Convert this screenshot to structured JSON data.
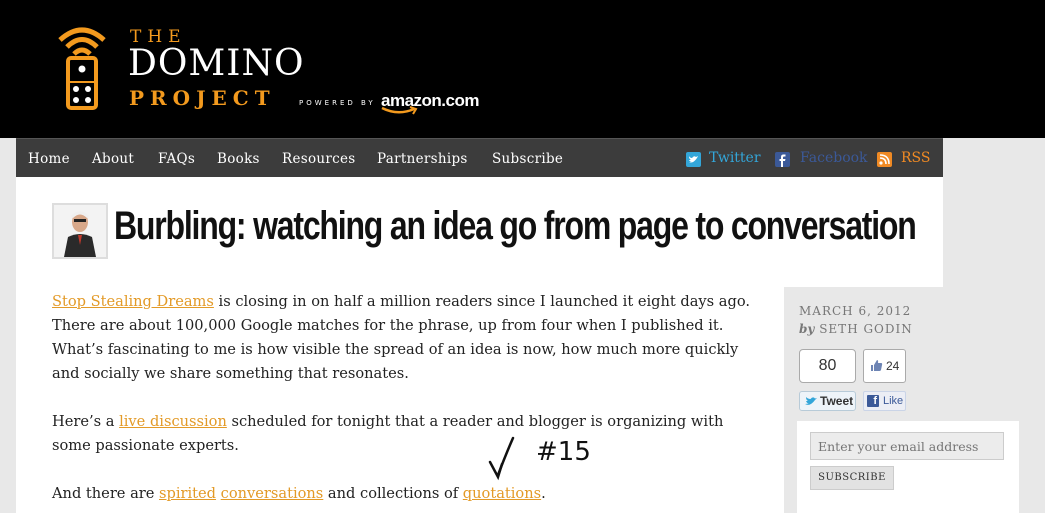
{
  "header": {
    "logo_the": "THE",
    "logo_domino": "DOMINO",
    "logo_project": "PROJECT",
    "powered_by": "POWERED BY",
    "amazon": "amazon.com"
  },
  "nav": {
    "items": [
      "Home",
      "About",
      "FAQs",
      "Books",
      "Resources",
      "Partnerships",
      "Subscribe"
    ],
    "twitter": "Twitter",
    "facebook": "Facebook",
    "rss": "RSS"
  },
  "post": {
    "title": "Burbling: watching an idea go from page to conversation",
    "p1_link": "Stop Stealing Dreams",
    "p1_text": " is closing in on half a million readers since I launched it eight days ago. There are about 100,000 Google matches for the phrase, up from four when I published it. What’s fascinating to me is how visible the spread of an idea is now, how much more quickly and socially we share something that resonates.",
    "p2_before": "Here’s a ",
    "p2_link": "live discussion",
    "p2_after": " scheduled for tonight that a reader and blogger is organizing with some passionate experts.",
    "p3_before": "And there are ",
    "p3_link1": "spirited",
    "p3_link2": "conversations",
    "p3_mid": " and collections of ",
    "p3_link3": "quotations",
    "p3_end": "."
  },
  "sidebar": {
    "date": "MARCH 6, 2012",
    "by": "by",
    "author": "SETH GODIN",
    "tweet_count": "80",
    "tweet_label": "Tweet",
    "like_count": "24",
    "like_label": "Like",
    "email_placeholder": "Enter your email address",
    "subscribe_label": "SUBSCRIBE"
  },
  "annotation": {
    "label": "#15"
  },
  "colors": {
    "accent": "#e39a27",
    "nav_bg": "#3c3c3c",
    "twitter": "#33a6d9",
    "facebook": "#3b5998"
  }
}
